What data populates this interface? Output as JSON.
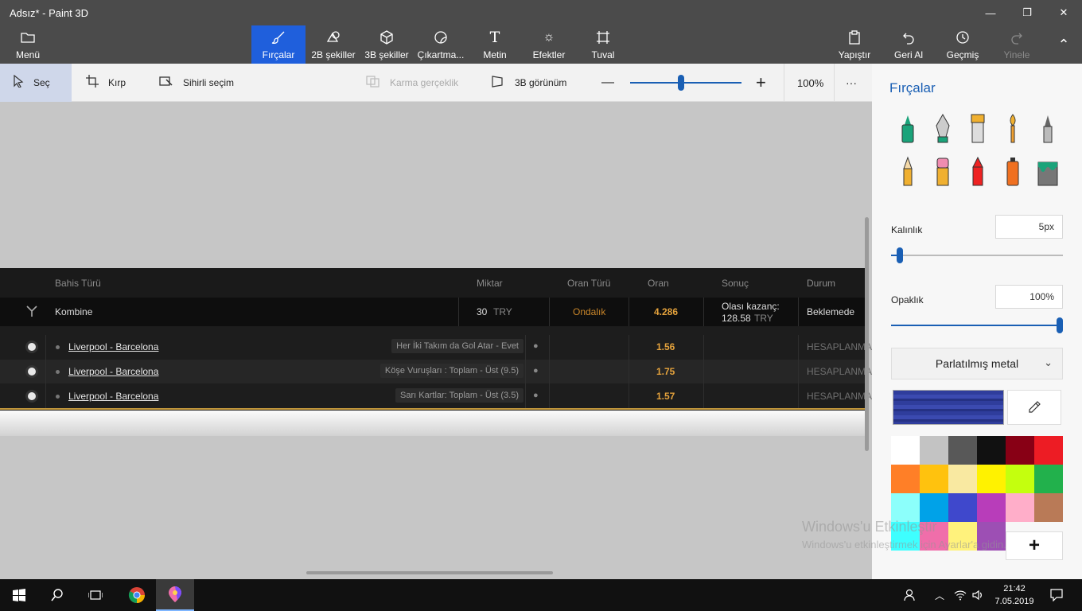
{
  "window": {
    "title": "Adsız* - Paint 3D",
    "minimize": "—",
    "restore": "❐",
    "close": "✕"
  },
  "ribbon": {
    "menu": "Menü",
    "brushes": "Fırçalar",
    "shapes2d": "2B şekiller",
    "shapes3d": "3B şekiller",
    "stickers": "Çıkartma...",
    "text": "Metin",
    "effects": "Efektler",
    "canvas": "Tuval",
    "paste": "Yapıştır",
    "undo": "Geri Al",
    "history": "Geçmiş",
    "redo": "Yinele",
    "collapse": "⌃"
  },
  "toolbar": {
    "select": "Seç",
    "crop": "Kırp",
    "magic_select": "Sihirli seçim",
    "mixed_reality": "Karma gerçeklik",
    "view3d": "3B görünüm",
    "zoom_out": "—",
    "zoom_in": "+",
    "zoom_level": "100%",
    "more": "···",
    "zoom_fraction": 0.46
  },
  "betslip": {
    "headers": {
      "type": "Bahis Türü",
      "amount": "Miktar",
      "odds_type": "Oran Türü",
      "odds": "Oran",
      "result": "Sonuç",
      "status": "Durum"
    },
    "summary": {
      "type": "Kombine",
      "amount": "30",
      "currency": "TRY",
      "odds_type": "Ondalık",
      "odds": "4.286",
      "possible_win_label": "Olası kazanç:",
      "possible_win_value": "128.58",
      "possible_win_currency": "TRY",
      "status": "Beklemede"
    },
    "rows": [
      {
        "match": "Liverpool - Barcelona",
        "market": "Her İki Takım da Gol Atar - Evet",
        "odds": "1.56",
        "status": "HESAPLANMA"
      },
      {
        "match": "Liverpool - Barcelona",
        "market": "Köşe Vuruşları : Toplam - Üst (9.5)",
        "odds": "1.75",
        "status": "HESAPLANMA"
      },
      {
        "match": "Liverpool - Barcelona",
        "market": "Sarı Kartlar: Toplam - Üst (3.5)",
        "odds": "1.57",
        "status": "HESAPLANMA"
      }
    ]
  },
  "panel": {
    "title": "Fırçalar",
    "thickness_label": "Kalınlık",
    "thickness_value": "5px",
    "thickness_fraction": 0.05,
    "opacity_label": "Opaklık",
    "opacity_value": "100%",
    "opacity_fraction": 1.0,
    "finish": "Parlatılmış metal",
    "chevron": "⌄",
    "selected_color": "#2f3d9c",
    "add_color": "+",
    "palette": [
      "#ffffff",
      "#c3c3c3",
      "#585858",
      "#111111",
      "#880015",
      "#ed1c24",
      "#ff7f27",
      "#ffc20e",
      "#f9e9a1",
      "#fff200",
      "#c4ff0e",
      "#22b14c",
      "#8cfffb",
      "#00a2e8",
      "#3f48cc",
      "#b83dba",
      "#ffaec9",
      "#b97a57",
      "#3effff",
      "#f06eaa",
      "#fff27c",
      "#9d4fb4"
    ]
  },
  "watermark": {
    "line1": "Windows'u Etkinleştir",
    "line2": "Windows'u etkinleştirmek için Ayarlar'a gidin."
  },
  "taskbar": {
    "time": "21:42",
    "date": "7.05.2019"
  }
}
